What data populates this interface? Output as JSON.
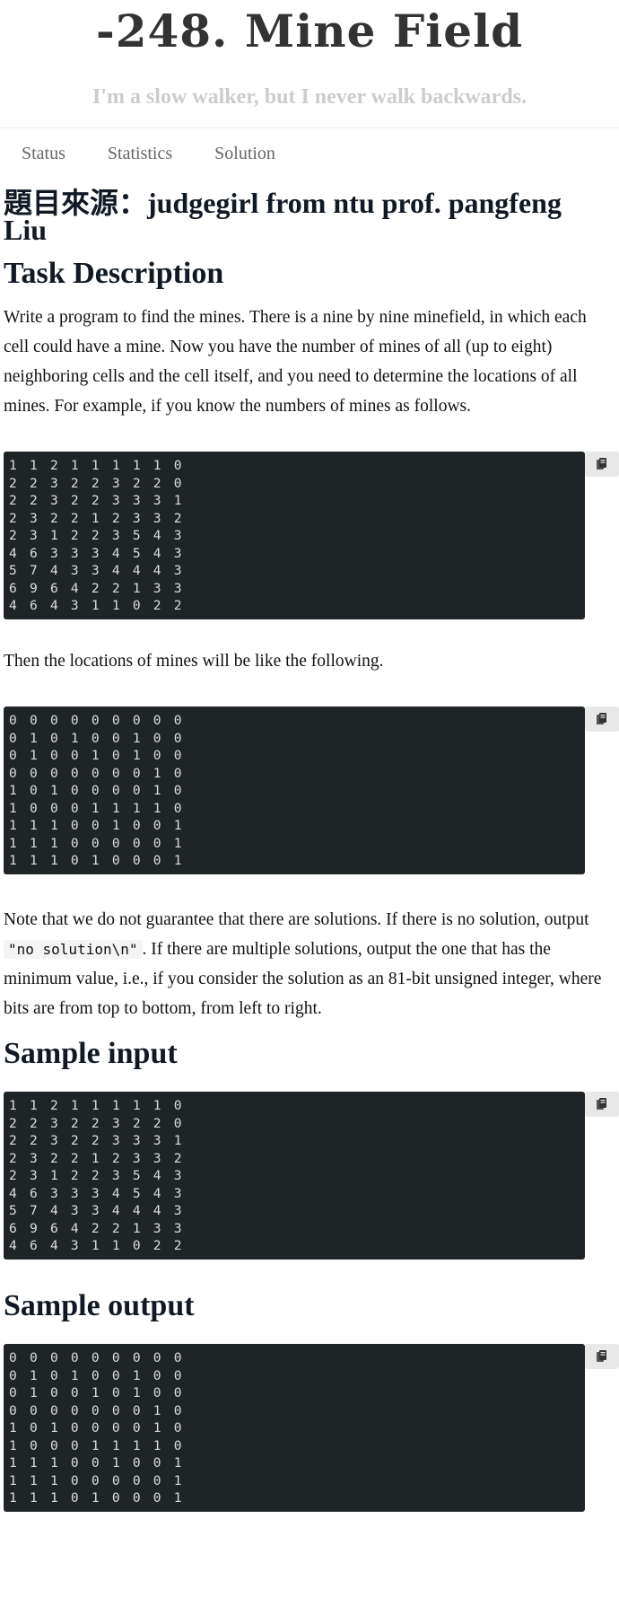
{
  "header": {
    "title": "-248. Mine Field",
    "subtitle": "I'm a slow walker, but I never walk backwards."
  },
  "nav": [
    "Status",
    "Statistics",
    "Solution"
  ],
  "source_heading": "題目來源：judgegirl from ntu prof. pangfeng Liu",
  "task_heading": "Task Description",
  "intro": "Write a program to find the mines. There is a nine by nine minefield, in which each cell could have a mine. Now you have the number of mines of all (up to eight) neighboring cells and the cell itself, and you need to determine the locations of all mines. For example, if you know the numbers of mines as follows.",
  "example_counts": "1 1 2 1 1 1 1 1 0\n2 2 3 2 2 3 2 2 0\n2 2 3 2 2 3 3 3 1\n2 3 2 2 1 2 3 3 2\n2 3 1 2 2 3 5 4 3\n4 6 3 3 3 4 5 4 3\n5 7 4 3 3 4 4 4 3\n6 9 6 4 2 2 1 3 3\n4 6 4 3 1 1 0 2 2",
  "then_text": "Then the locations of mines will be like the following.",
  "example_mines": "0 0 0 0 0 0 0 0 0\n0 1 0 1 0 0 1 0 0\n0 1 0 0 1 0 1 0 0\n0 0 0 0 0 0 0 1 0\n1 0 1 0 0 0 0 1 0\n1 0 0 0 1 1 1 1 0\n1 1 1 0 0 1 0 0 1\n1 1 1 0 0 0 0 0 1\n1 1 1 0 1 0 0 0 1",
  "note": {
    "before": "Note that we do not guarantee that there are solutions. If there is no solution, output ",
    "code": "\"no solution\\n\"",
    "after": ". If there are multiple solutions, output the one that has the minimum value, i.e., if you consider the solution as an 81-bit unsigned integer, where bits are from top to bottom, from left to right."
  },
  "sample_input_heading": "Sample input",
  "sample_input": "1 1 2 1 1 1 1 1 0\n2 2 3 2 2 3 2 2 0\n2 2 3 2 2 3 3 3 1\n2 3 2 2 1 2 3 3 2\n2 3 1 2 2 3 5 4 3\n4 6 3 3 3 4 5 4 3\n5 7 4 3 3 4 4 4 3\n6 9 6 4 2 2 1 3 3\n4 6 4 3 1 1 0 2 2",
  "sample_output_heading": "Sample output",
  "sample_output": "0 0 0 0 0 0 0 0 0\n0 1 0 1 0 0 1 0 0\n0 1 0 0 1 0 1 0 0\n0 0 0 0 0 0 0 1 0\n1 0 1 0 0 0 0 1 0\n1 0 0 0 1 1 1 1 0\n1 1 1 0 0 1 0 0 1\n1 1 1 0 0 0 0 0 1\n1 1 1 0 1 0 0 0 1",
  "icons": {
    "copy": "clipboard-icon"
  }
}
